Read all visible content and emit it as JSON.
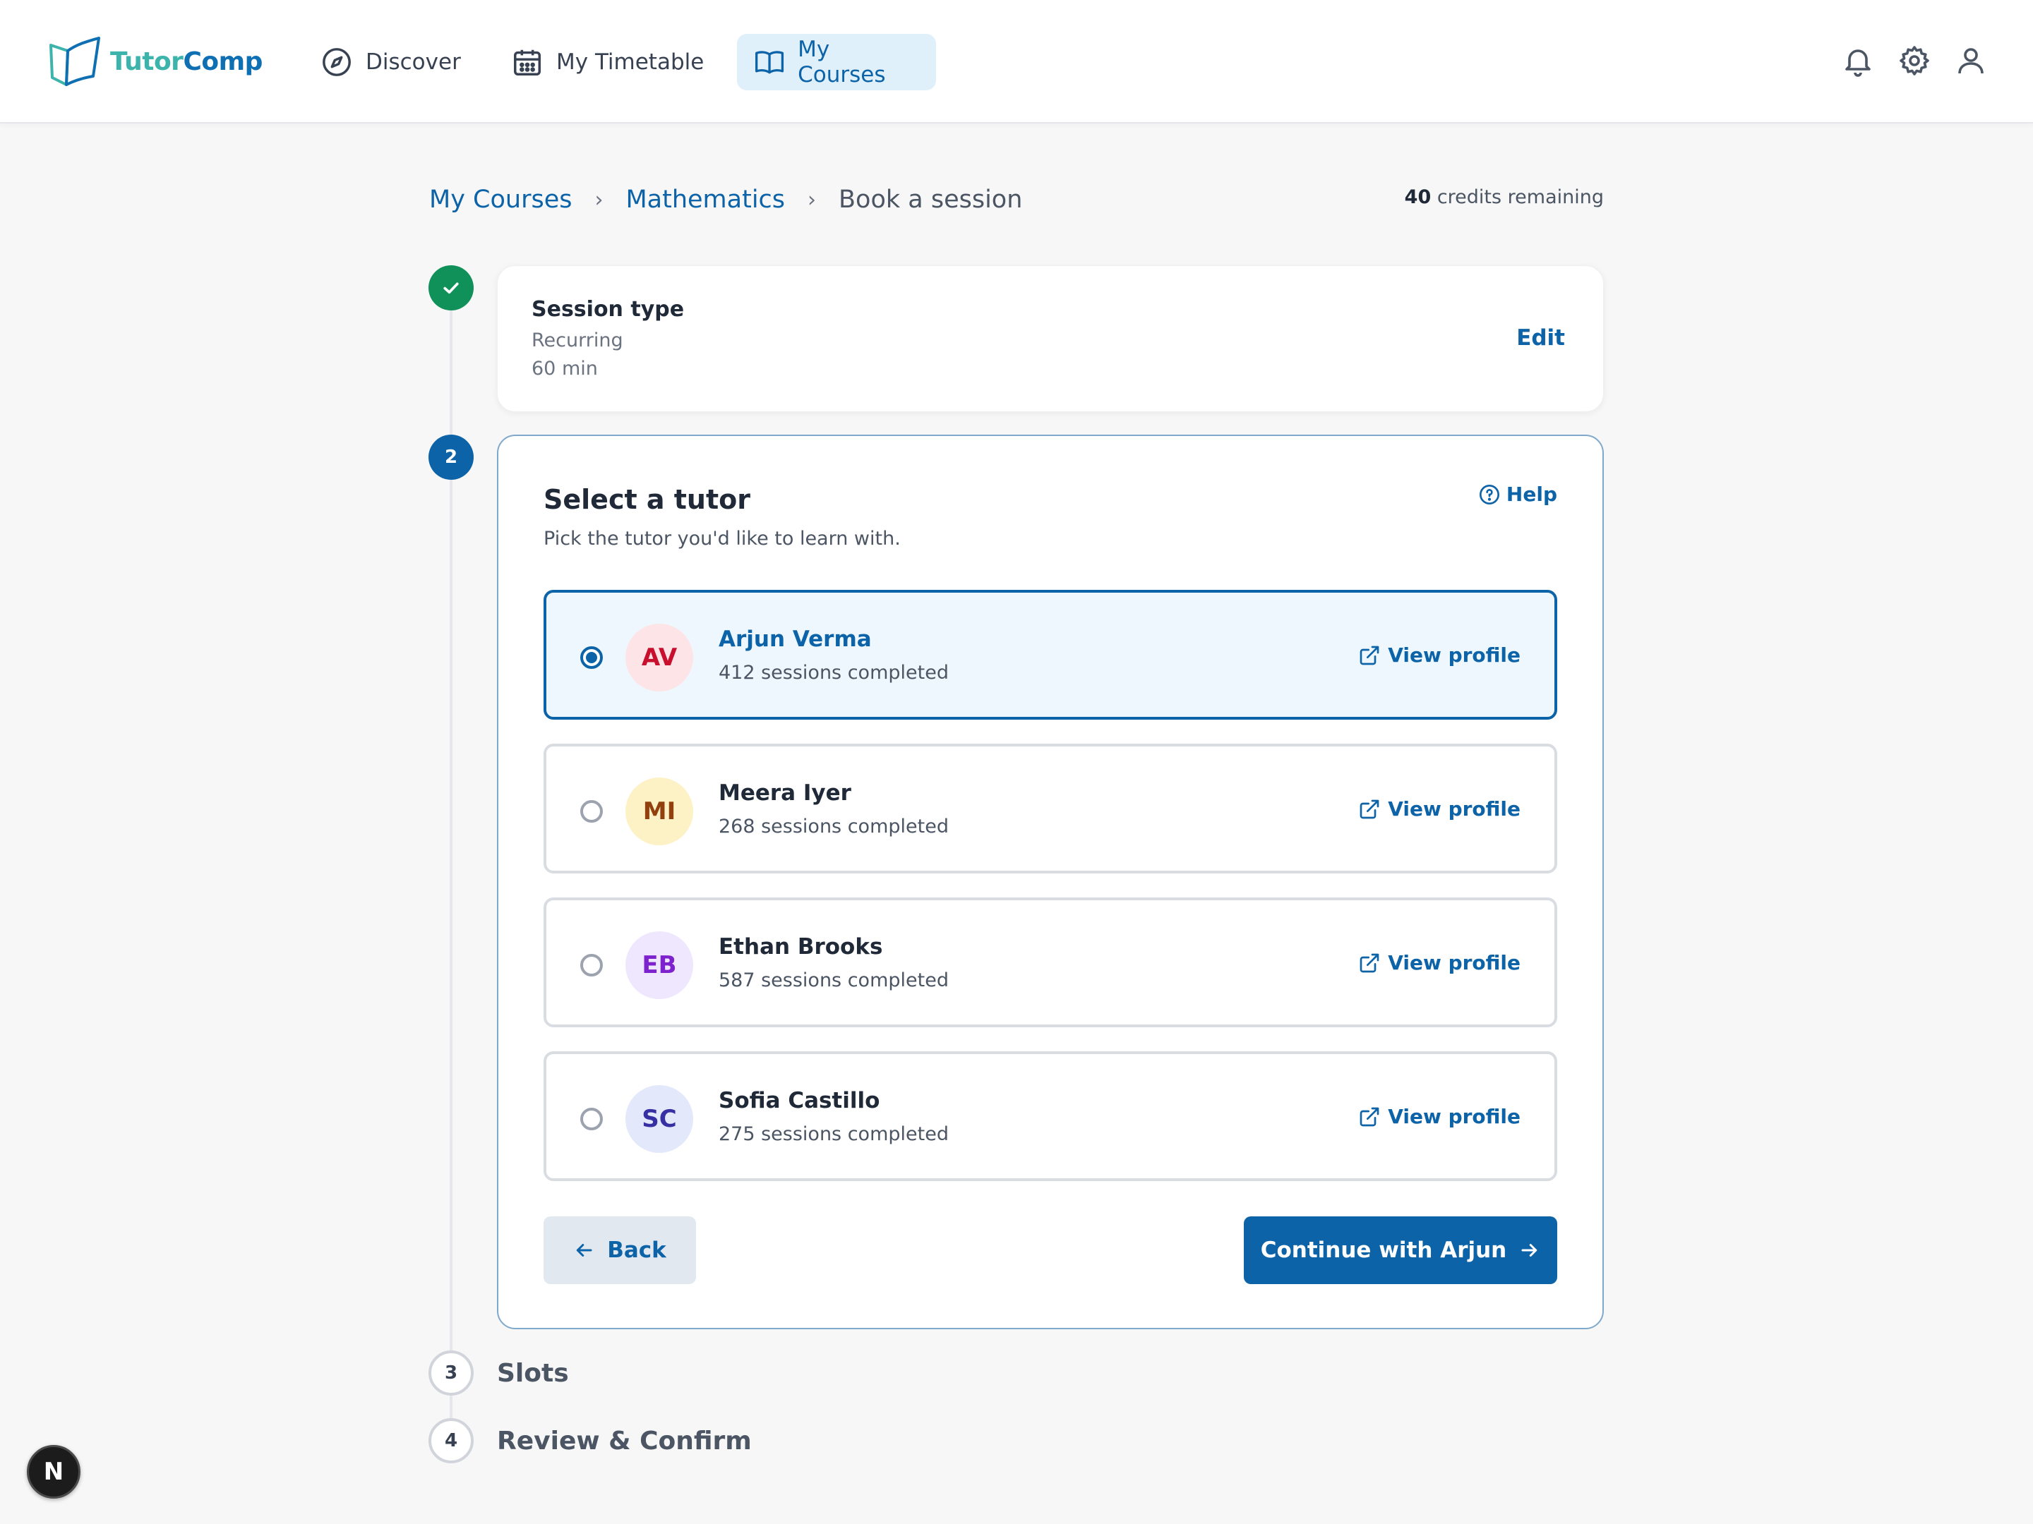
{
  "app": {
    "logo_part1": "Tutor",
    "logo_part2": "Comp"
  },
  "nav": {
    "discover": "Discover",
    "timetable": "My Timetable",
    "courses": "My Courses"
  },
  "breadcrumb": {
    "items": [
      "My Courses",
      "Mathematics",
      "Book a session"
    ],
    "separator": "›"
  },
  "credits": {
    "count": "40",
    "suffix": " credits remaining"
  },
  "steps": {
    "step1": {
      "title": "Session type",
      "line1": "Recurring",
      "line2": "60 min",
      "edit_label": "Edit"
    },
    "step2": {
      "number": "2",
      "title": "Select a tutor",
      "subtitle": "Pick the tutor you'd like to learn with.",
      "help_label": "Help"
    },
    "step3": {
      "number": "3",
      "label": "Slots"
    },
    "step4": {
      "number": "4",
      "label": "Review & Confirm"
    }
  },
  "tutors": [
    {
      "initials": "AV",
      "name": "Arjun Verma",
      "sessions": "412 sessions completed",
      "link": "View profile",
      "selected": true,
      "avatar_bg": "#fde4e6",
      "avatar_fg": "#c8102e"
    },
    {
      "initials": "MI",
      "name": "Meera Iyer",
      "sessions": "268 sessions completed",
      "link": "View profile",
      "selected": false,
      "avatar_bg": "#fdf1c6",
      "avatar_fg": "#92400e"
    },
    {
      "initials": "EB",
      "name": "Ethan Brooks",
      "sessions": "587 sessions completed",
      "link": "View profile",
      "selected": false,
      "avatar_bg": "#efe7fd",
      "avatar_fg": "#7e22ce"
    },
    {
      "initials": "SC",
      "name": "Sofia Castillo",
      "sessions": "275 sessions completed",
      "link": "View profile",
      "selected": false,
      "avatar_bg": "#e3e8fb",
      "avatar_fg": "#3730a3"
    }
  ],
  "buttons": {
    "back": "Back",
    "continue": "Continue with Arjun"
  },
  "badge": "N",
  "colors": {
    "primary": "#0c63a8",
    "success": "#10915a",
    "selected_bg": "#eef7fd"
  }
}
